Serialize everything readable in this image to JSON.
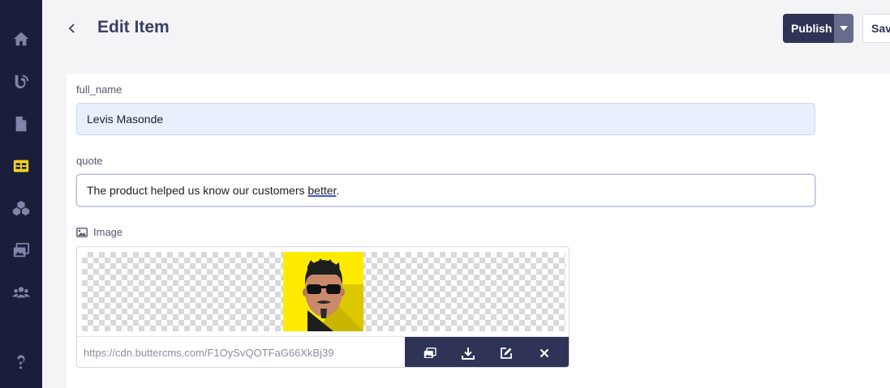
{
  "header": {
    "title": "Edit Item",
    "publish_label": "Publish",
    "save_label": "Sav"
  },
  "sidebar": {
    "items": [
      {
        "icon": "home-icon"
      },
      {
        "icon": "blog-icon"
      },
      {
        "icon": "page-icon"
      },
      {
        "icon": "collection-icon",
        "active": true
      },
      {
        "icon": "components-icon"
      },
      {
        "icon": "media-icon"
      },
      {
        "icon": "users-icon"
      },
      {
        "icon": "help-icon"
      }
    ]
  },
  "form": {
    "full_name_label": "full_name",
    "full_name_value": "Levis Masonde",
    "quote_label": "quote",
    "quote_value_before": "The product helped us know our customers ",
    "quote_value_underlined": "better",
    "quote_value_after": ".",
    "image_label": "Image",
    "image_url": "https://cdn.buttercms.com/F1OySvQOTFaG66XkBj39"
  },
  "colors": {
    "sidebar_bg": "#1b1e3a",
    "sidebar_icon": "#7f84a8",
    "sidebar_active": "#f5d418",
    "primary": "#2f3457",
    "avatar_bg": "#ffea00"
  }
}
